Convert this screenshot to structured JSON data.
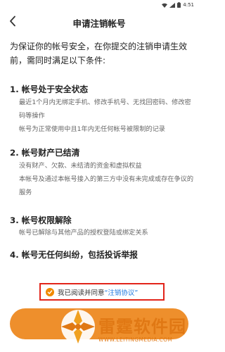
{
  "status_bar": {
    "time": "4:51"
  },
  "header": {
    "title": "申请注销帐号"
  },
  "intro": "为保证你的帐号安全，在你提交的注销申请生效前，需同时满足以下条件:",
  "sections": [
    {
      "heading": "1. 帐号处于安全状态",
      "lines": [
        "最近1个月内无绑定手机、修改手机号、无找回密码、修改密码等操作",
        "帐号为正常使用中且1年内无任何帐号被限制的记录"
      ]
    },
    {
      "heading": "2. 帐号财产已结清",
      "lines": [
        "没有财产、欠款、未结清的资金和虚拟权益",
        "本帐号及通过本帐号接入的第三方中没有未完成或存在争议的服务"
      ]
    },
    {
      "heading": "3. 帐号权限解除",
      "lines": [
        "帐号已解除与其他产品的授权登陆或绑定关系"
      ]
    },
    {
      "heading": "4. 帐号无任何纠纷，包括投诉举报",
      "lines": []
    }
  ],
  "agreement": {
    "prefix": "我已阅读并同意",
    "link": "“注销协议”",
    "checked": true
  },
  "watermark": {
    "name": "雷霆软件园",
    "url": "WWW.LEITINGMEDIA.COM"
  },
  "colors": {
    "accent": "#ee8f2c",
    "link": "#1f7ae0",
    "highlight_border": "#e2241a"
  }
}
